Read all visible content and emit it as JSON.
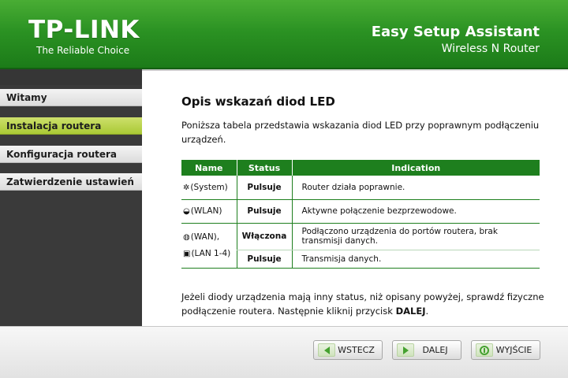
{
  "header": {
    "logo": "TP-LINK",
    "tagline": "The Reliable Choice",
    "title": "Easy Setup Assistant",
    "subtitle": "Wireless N Router",
    "color": "#2b9223"
  },
  "sidebar": {
    "items": [
      {
        "label": "Witamy",
        "active": false
      },
      {
        "label": "Instalacja routera",
        "active": true
      },
      {
        "label": "Konfiguracja routera",
        "active": false
      },
      {
        "label": "Zatwierdzenie ustawień",
        "active": false
      }
    ],
    "active_color": "#b8d23f"
  },
  "main": {
    "title": "Opis wskazań diod LED",
    "intro": "Poniższa tabela przedstawia wskazania diod LED przy poprawnym podłączeniu urządzeń.",
    "table": {
      "headers": [
        "Name",
        "Status",
        "Indication"
      ],
      "rows": [
        {
          "icon": "gear-icon",
          "glyph": "✲",
          "name": "(System)",
          "status": "Pulsuje",
          "indication": "Router działa poprawnie."
        },
        {
          "icon": "wifi-icon",
          "glyph": "◒",
          "name": "(WLAN)",
          "status": "Pulsuje",
          "indication": "Aktywne połączenie bezprzewodowe."
        },
        {
          "icon": "globe-icon",
          "glyph": "◍",
          "name": "(WAN),",
          "status": "Włączona",
          "indication": "Podłączono urządzenia do portów routera, brak transmisji danych."
        },
        {
          "icon": "monitor-icon",
          "glyph": "▣",
          "name": "(LAN 1-4)",
          "status": "Pulsuje",
          "indication": "Transmisja danych."
        }
      ]
    },
    "footer_text_before": "Jeżeli diody urządzenia mają inny status, niż opisany powyżej, sprawdź fizyczne podłączenie routera. Następnie kliknij przycisk ",
    "footer_text_bold": "DALEJ",
    "footer_text_after": "."
  },
  "buttons": {
    "back": "WSTECZ",
    "next": "DALEJ",
    "exit": "WYJŚCIE"
  }
}
